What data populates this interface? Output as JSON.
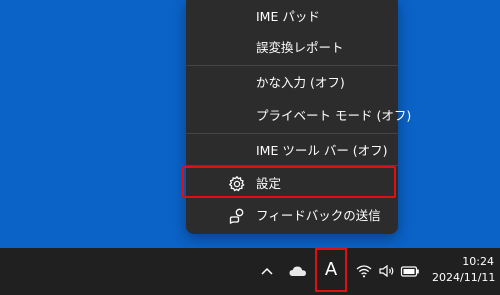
{
  "menu": {
    "items": [
      {
        "label": "IME パッド"
      },
      {
        "label": "誤変換レポート"
      },
      {
        "label": "かな入力 (オフ)"
      },
      {
        "label": "プライベート モード (オフ)"
      },
      {
        "label": "IME ツール バー (オフ)"
      },
      {
        "label": "設定",
        "icon": "gear-icon"
      },
      {
        "label": "フィードバックの送信",
        "icon": "feedback-icon"
      }
    ]
  },
  "taskbar": {
    "ime_indicator": "A",
    "clock": {
      "time": "10:24",
      "date": "2024/11/11"
    },
    "icons": [
      "chevron-up-icon",
      "cloud-icon",
      "wifi-icon",
      "volume-icon",
      "battery-icon"
    ]
  },
  "colors": {
    "desktop": "#0b62c7",
    "menu_bg": "#2c2c2c",
    "taskbar_bg": "#202020",
    "highlight": "#e01010"
  }
}
